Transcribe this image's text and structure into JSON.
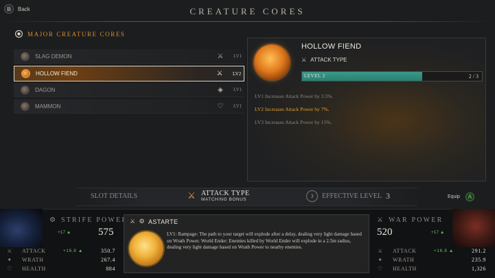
{
  "header": {
    "back_label": "Back",
    "back_icon": "b-button-icon",
    "title": "CREATURE CORES"
  },
  "cores_list": {
    "section_title": "MAJOR CREATURE CORES",
    "items": [
      {
        "name": "SLAG DEMON",
        "type_icon": "attack-type-icon",
        "level": "LV1",
        "selected": false
      },
      {
        "name": "HOLLOW FIEND",
        "type_icon": "attack-type-icon",
        "level": "LV2",
        "selected": true
      },
      {
        "name": "DAGON",
        "type_icon": "diamond-type-icon",
        "level": "LV1",
        "selected": false
      },
      {
        "name": "MAMMON",
        "type_icon": "heart-type-icon",
        "level": "LV1",
        "selected": false
      }
    ]
  },
  "detail": {
    "name": "HOLLOW FIEND",
    "type_label": "ATTACK TYPE",
    "level_label": "LEVEL 2",
    "level_current": 2,
    "level_max": 3,
    "level_count_text": "2 / 3",
    "level_progress": 0.667,
    "bonuses": [
      {
        "text": "LV1 Increases Attack Power by 3.5%.",
        "active": false
      },
      {
        "text": "LV2 Increases Attack Power by 7%.",
        "active": true
      },
      {
        "text": "LV3 Increases Attack Power by 15%.",
        "active": false
      }
    ],
    "accent_color": "#e0a030",
    "bar_color": "#2a8f7f"
  },
  "tabs": {
    "slot_details": "SLOT DETAILS",
    "attack_type": "ATTACK TYPE",
    "matching_bonus": "MATCHING BONUS",
    "effective_icon_number": "3",
    "effective_level_label": "EFFECTIVE LEVEL",
    "effective_level_value": "3",
    "equip_label": "Equip",
    "equip_button": "A"
  },
  "left_stats": {
    "power_title": "STRIFE POWER",
    "power_delta": "+17",
    "power_value": "575",
    "rows": [
      {
        "name": "ATTACK",
        "delta": "+16.8",
        "value": "350.7",
        "icon": "sword-icon"
      },
      {
        "name": "WRATH",
        "delta": "",
        "value": "267.4",
        "icon": "wrath-icon"
      },
      {
        "name": "HEALTH",
        "delta": "",
        "value": "884",
        "icon": "heart-icon"
      }
    ]
  },
  "right_stats": {
    "power_title": "WAR POWER",
    "power_delta": "+17",
    "power_value": "520",
    "rows": [
      {
        "name": "ATTACK",
        "delta": "+16.8",
        "value": "291.2",
        "icon": "sword-icon"
      },
      {
        "name": "WRATH",
        "delta": "",
        "value": "235.9",
        "icon": "wrath-icon"
      },
      {
        "name": "HEALTH",
        "delta": "",
        "value": "1,326",
        "icon": "heart-icon"
      }
    ]
  },
  "center_card": {
    "name": "ASTARTE",
    "description": "LV1: Rampage: The path to your target will explode after a delay, dealing very light damage based on Wrath Power.  World Ender: Enemies killed by World Ender will explode in a 2.5m radius, dealing very light damage based on Wrath Power to nearby enemies."
  }
}
